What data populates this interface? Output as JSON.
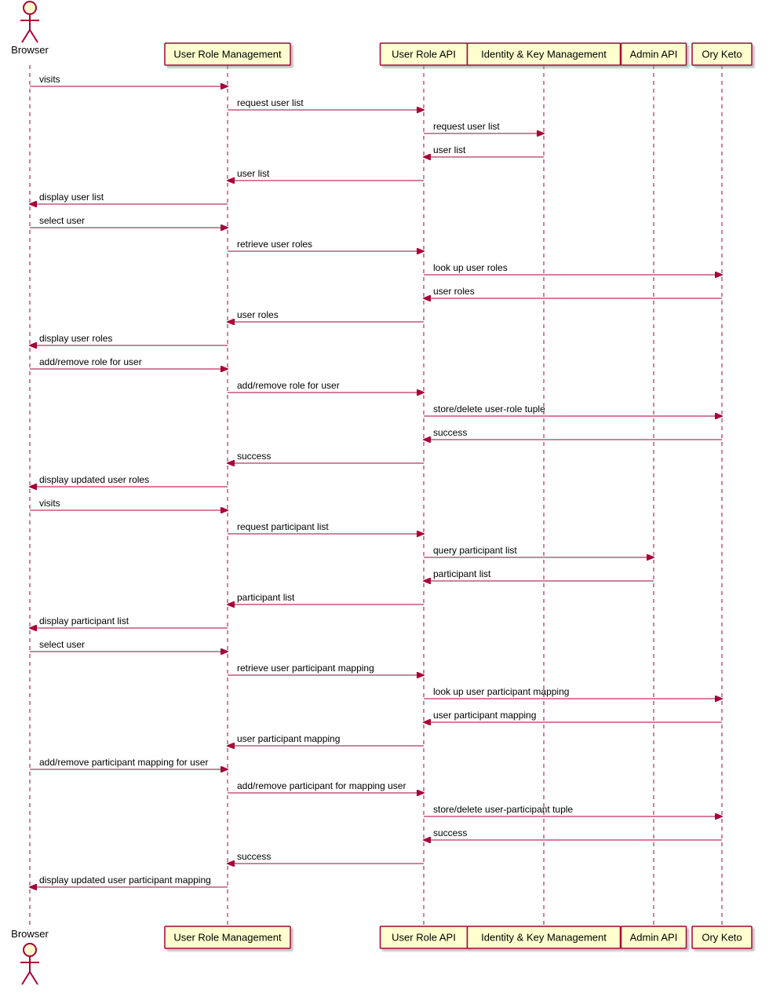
{
  "actors": {
    "browser": "Browser"
  },
  "participants": {
    "urm": "User Role Management",
    "ura": "User Role API",
    "ikm": "Identity & Key Management",
    "admin": "Admin API",
    "keto": "Ory Keto"
  },
  "messages": [
    {
      "from": "browser",
      "to": "urm",
      "text": "visits"
    },
    {
      "from": "urm",
      "to": "ura",
      "text": "request user list"
    },
    {
      "from": "ura",
      "to": "ikm",
      "text": "request user list"
    },
    {
      "from": "ikm",
      "to": "ura",
      "text": "user list"
    },
    {
      "from": "ura",
      "to": "urm",
      "text": "user list"
    },
    {
      "from": "urm",
      "to": "browser",
      "text": "display user list"
    },
    {
      "from": "browser",
      "to": "urm",
      "text": "select user"
    },
    {
      "from": "urm",
      "to": "ura",
      "text": "retrieve user roles"
    },
    {
      "from": "ura",
      "to": "keto",
      "text": "look up user roles"
    },
    {
      "from": "keto",
      "to": "ura",
      "text": "user roles"
    },
    {
      "from": "ura",
      "to": "urm",
      "text": "user roles"
    },
    {
      "from": "urm",
      "to": "browser",
      "text": "display user roles"
    },
    {
      "from": "browser",
      "to": "urm",
      "text": "add/remove role for user"
    },
    {
      "from": "urm",
      "to": "ura",
      "text": "add/remove role for user"
    },
    {
      "from": "ura",
      "to": "keto",
      "text": "store/delete user-role tuple"
    },
    {
      "from": "keto",
      "to": "ura",
      "text": "success"
    },
    {
      "from": "ura",
      "to": "urm",
      "text": "success"
    },
    {
      "from": "urm",
      "to": "browser",
      "text": "display updated user roles"
    },
    {
      "from": "browser",
      "to": "urm",
      "text": "visits"
    },
    {
      "from": "urm",
      "to": "ura",
      "text": "request participant list"
    },
    {
      "from": "ura",
      "to": "admin",
      "text": "query participant list"
    },
    {
      "from": "admin",
      "to": "ura",
      "text": "participant list"
    },
    {
      "from": "ura",
      "to": "urm",
      "text": "participant list"
    },
    {
      "from": "urm",
      "to": "browser",
      "text": "display participant list"
    },
    {
      "from": "browser",
      "to": "urm",
      "text": "select user"
    },
    {
      "from": "urm",
      "to": "ura",
      "text": "retrieve user participant mapping"
    },
    {
      "from": "ura",
      "to": "keto",
      "text": "look up user participant mapping"
    },
    {
      "from": "keto",
      "to": "ura",
      "text": "user participant mapping"
    },
    {
      "from": "ura",
      "to": "urm",
      "text": "user participant mapping"
    },
    {
      "from": "browser",
      "to": "urm",
      "text": "add/remove participant mapping for user"
    },
    {
      "from": "urm",
      "to": "ura",
      "text": "add/remove participant for mapping user"
    },
    {
      "from": "ura",
      "to": "keto",
      "text": "store/delete user-participant tuple"
    },
    {
      "from": "keto",
      "to": "ura",
      "text": "success"
    },
    {
      "from": "ura",
      "to": "urm",
      "text": "success"
    },
    {
      "from": "urm",
      "to": "browser",
      "text": "display updated user participant mapping"
    }
  ],
  "colors": {
    "box_fill": "#fefece",
    "stroke": "#a80036"
  }
}
